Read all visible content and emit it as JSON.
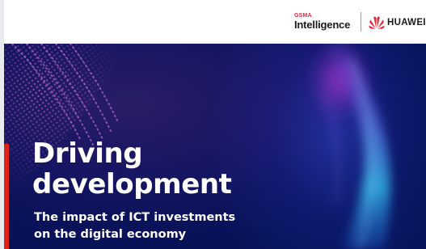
{
  "header": {
    "gsma_small": "GSMA",
    "gsma_main": "Intelligence",
    "huawei_text": "HUAWEI",
    "logo_icons": [
      "gsma-intelligence-logo",
      "huawei-flower-icon"
    ]
  },
  "hero": {
    "title_lines": [
      "Driving",
      "development"
    ],
    "subtitle_lines": [
      "The impact of ICT investments",
      "on the digital economy"
    ]
  },
  "colors": {
    "background_navy": "#0d1a6d",
    "accent_red": "#e0201b",
    "glow_magenta": "#d13fe6",
    "glow_cyan": "#36c9f5",
    "text_white": "#ffffff"
  }
}
